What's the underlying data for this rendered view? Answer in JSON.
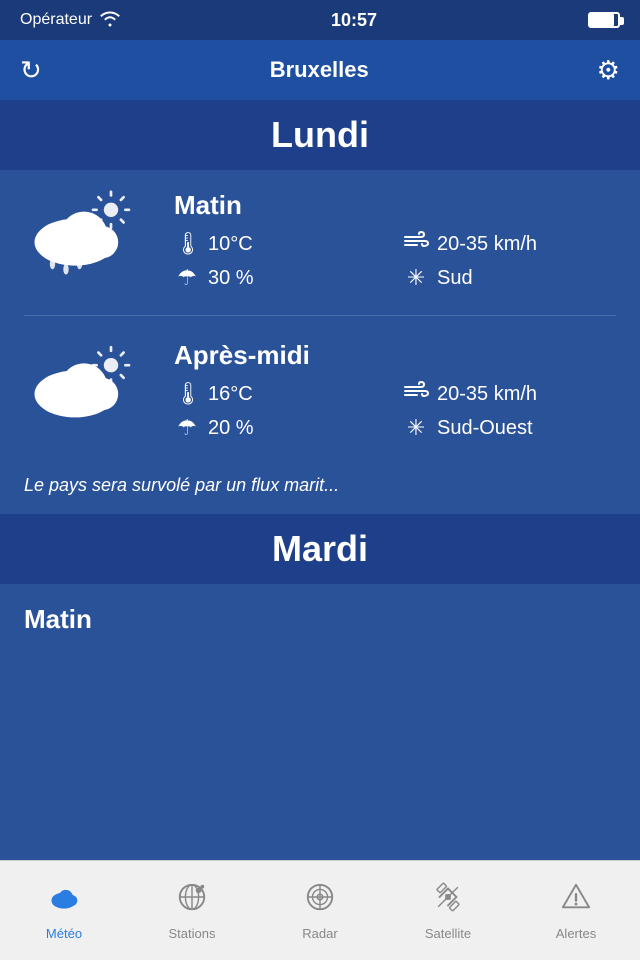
{
  "status_bar": {
    "carrier": "Opérateur",
    "time": "10:57"
  },
  "header": {
    "title": "Bruxelles",
    "refresh_label": "↻",
    "settings_label": "⚙"
  },
  "lundi": {
    "day_label": "Lundi",
    "matin": {
      "period_label": "Matin",
      "temperature": "10°C",
      "precipitation": "30 %",
      "wind": "20-35 km/h",
      "direction": "Sud"
    },
    "apres_midi": {
      "period_label": "Après-midi",
      "temperature": "16°C",
      "precipitation": "20 %",
      "wind": "20-35 km/h",
      "direction": "Sud-Ouest"
    },
    "description": "Le pays sera survolé par un flux marit..."
  },
  "mardi": {
    "day_label": "Mardi",
    "matin": {
      "period_label": "Matin"
    }
  },
  "tab_bar": {
    "tabs": [
      {
        "id": "meteo",
        "label": "Météo",
        "active": true
      },
      {
        "id": "stations",
        "label": "Stations",
        "active": false
      },
      {
        "id": "radar",
        "label": "Radar",
        "active": false
      },
      {
        "id": "satellite",
        "label": "Satellite",
        "active": false
      },
      {
        "id": "alertes",
        "label": "Alertes",
        "active": false
      }
    ]
  }
}
